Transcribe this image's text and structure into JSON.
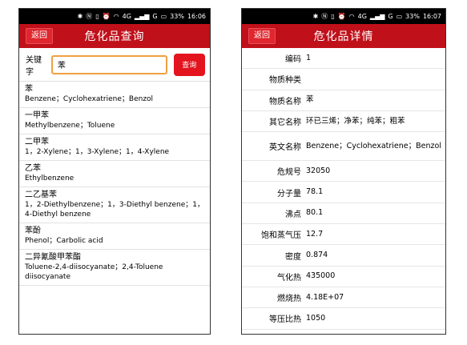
{
  "status": {
    "network": "4G",
    "network2": "G",
    "battery": "33%",
    "time_left": "16:06",
    "time_right": "16:07"
  },
  "search_screen": {
    "back_label": "返回",
    "title": "危化品查询",
    "keyword_label": "关键字",
    "keyword_value": "苯",
    "query_label": "查询",
    "results": [
      {
        "name": "苯",
        "english": "Benzene；Cyclohexatriene；Benzol"
      },
      {
        "name": "一甲苯",
        "english": "Methylbenzene；Toluene"
      },
      {
        "name": "二甲苯",
        "english": "1，2-Xylene；1，3-Xylene；1，4-Xylene"
      },
      {
        "name": "乙苯",
        "english": "Ethylbenzene"
      },
      {
        "name": "二乙基苯",
        "english": "1，2-Diethylbenzene；1，3-Diethyl benzene；1，4-Diethyl benzene"
      },
      {
        "name": "苯酚",
        "english": "Phenol；Carbolic acid"
      },
      {
        "name": "二异氰酸甲苯酯",
        "english": "Toluene-2,4-diisocyanate；2,4-Toluene diisocyanate"
      }
    ]
  },
  "detail_screen": {
    "back_label": "返回",
    "title": "危化品详情",
    "rows": [
      {
        "label": "编码",
        "value": "1"
      },
      {
        "label": "物质种类",
        "value": ""
      },
      {
        "label": "物质名称",
        "value": "苯"
      },
      {
        "label": "其它名称",
        "value": "环已三烯；净苯；纯苯；粗苯"
      },
      {
        "label": "英文名称",
        "value": "Benzene；Cyclohexatriene；Benzol"
      },
      {
        "label": "危规号",
        "value": "32050"
      },
      {
        "label": "分子量",
        "value": "78.1"
      },
      {
        "label": "沸点",
        "value": "80.1"
      },
      {
        "label": "饱和蒸气压",
        "value": "12.7"
      },
      {
        "label": "密度",
        "value": "0.874"
      },
      {
        "label": "气化热",
        "value": "435000"
      },
      {
        "label": "燃烧热",
        "value": "4.18E+07"
      },
      {
        "label": "等压比热",
        "value": "1050"
      }
    ]
  }
}
